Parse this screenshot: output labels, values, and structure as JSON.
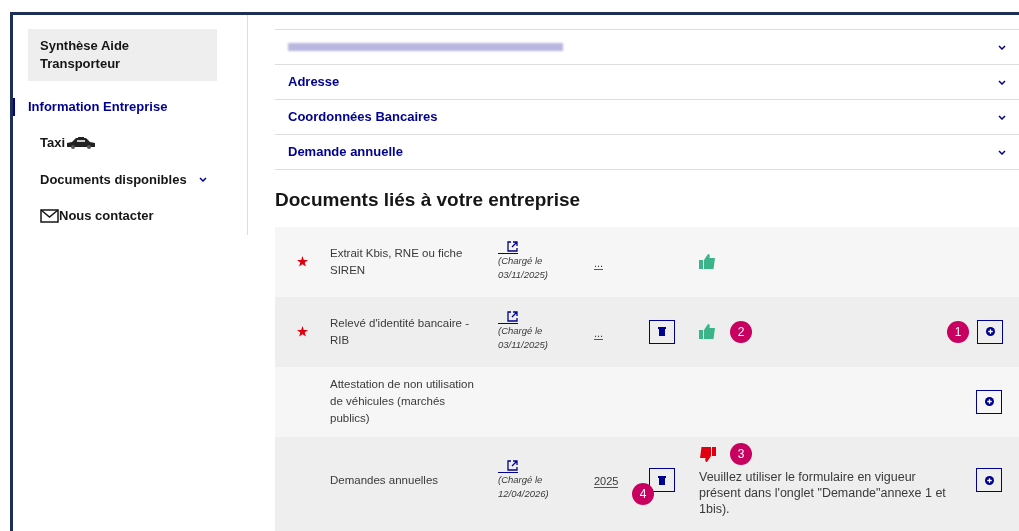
{
  "sidebar": {
    "items": [
      {
        "label": "Synthèse Aide Transporteur",
        "selected": false,
        "kind": "highlight"
      },
      {
        "label": "Information Entreprise",
        "selected": true,
        "kind": "link"
      },
      {
        "label": "Taxi",
        "selected": false,
        "kind": "taxi"
      },
      {
        "label": "Documents disponibles",
        "selected": false,
        "kind": "dropdown"
      },
      {
        "label": "Nous contacter",
        "selected": false,
        "kind": "mail"
      }
    ]
  },
  "accordion": [
    {
      "kind": "blurred",
      "expanded": false
    },
    {
      "kind": "text",
      "label": "Adresse",
      "expanded": false
    },
    {
      "kind": "text",
      "label": "Coordonnées Bancaires",
      "expanded": false
    },
    {
      "kind": "text",
      "label": "Demande annuelle",
      "expanded": false
    }
  ],
  "documents": {
    "title": "Documents liés à votre entreprise",
    "rows": [
      {
        "required": true,
        "label": "Extrait Kbis, RNE ou fiche SIREN",
        "loaded": "(Chargé le 03/11/2025)",
        "year": "...",
        "deletable": false,
        "approved": true,
        "addable": false
      },
      {
        "required": true,
        "label": "Relevé d'identité bancaire - RIB",
        "loaded": "(Chargé le 03/11/2025)",
        "year": "...",
        "deletable": true,
        "approved": true,
        "status_badge": "2",
        "addable": true,
        "add_badge": "1"
      },
      {
        "required": false,
        "label": "Attestation de non utilisation de véhicules (marchés publics)",
        "deletable": false,
        "addable": true
      },
      {
        "required": false,
        "label": "Demandes annuelles",
        "loaded": "(Chargé le 12/04/2026)",
        "year": "2025",
        "deletable": true,
        "delete_badge": "4",
        "approved": false,
        "status_badge": "3",
        "message": "Veuillez utiliser le formulaire en vigueur présent dans l'onglet \"Demande\"annexe 1 et 1bis).",
        "addable": true
      }
    ]
  }
}
